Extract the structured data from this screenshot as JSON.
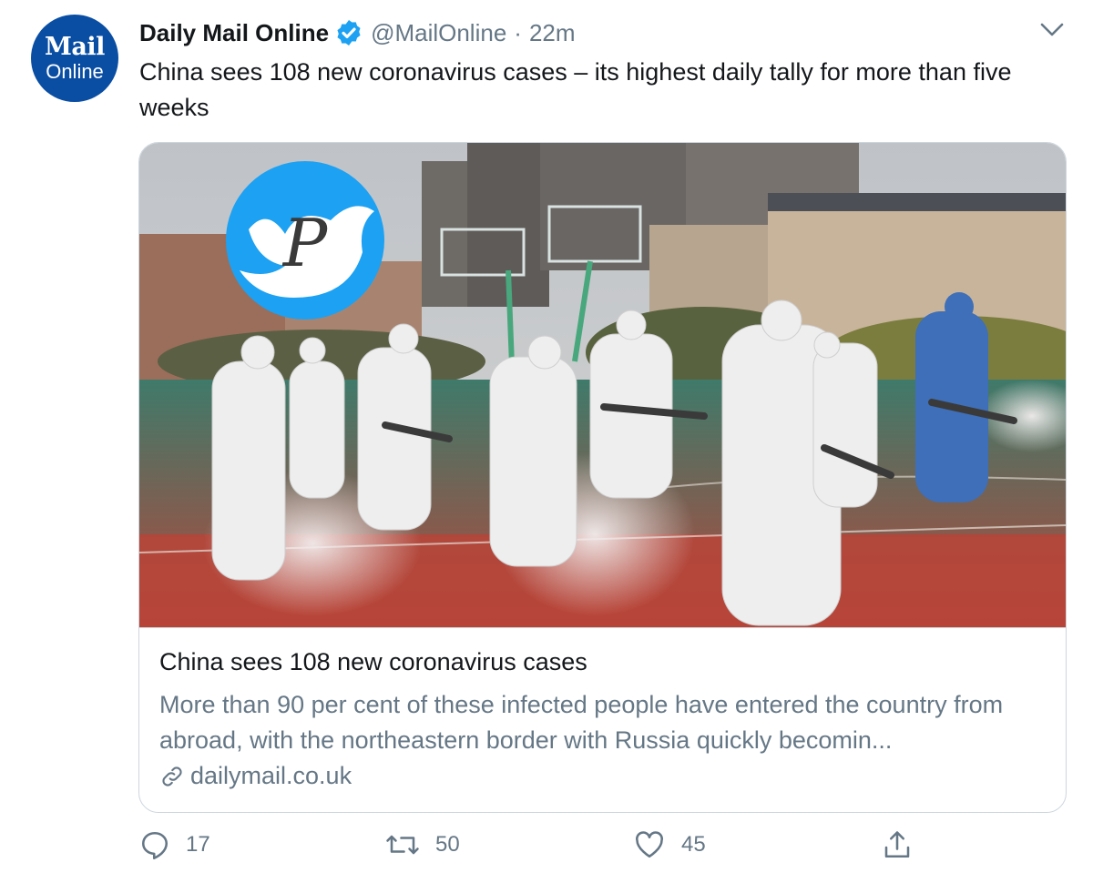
{
  "author": {
    "avatar_line1": "Mail",
    "avatar_line2": "Online",
    "display_name": "Daily Mail Online",
    "handle": "@MailOnline",
    "separator": "·",
    "time": "22m"
  },
  "tweet": {
    "text": "China sees 108 new coronavirus cases – its highest daily tally for more than five weeks"
  },
  "card": {
    "title": "China sees 108 new coronavirus cases",
    "description": "More than 90 per cent of these infected people have entered the country from abroad, with the northeastern border with Russia quickly becomin...",
    "domain": "dailymail.co.uk",
    "watermark_letter": "P"
  },
  "actions": {
    "replies": "17",
    "retweets": "50",
    "likes": "45"
  },
  "colors": {
    "verified": "#1da1f2",
    "muted_text": "#657786",
    "avatar_bg": "#0a4ea3",
    "border": "#ccd6dd"
  },
  "icons": [
    "verified-badge-icon",
    "chevron-down-icon",
    "link-icon",
    "reply-icon",
    "retweet-icon",
    "like-icon",
    "share-icon",
    "twitter-bird-icon"
  ]
}
